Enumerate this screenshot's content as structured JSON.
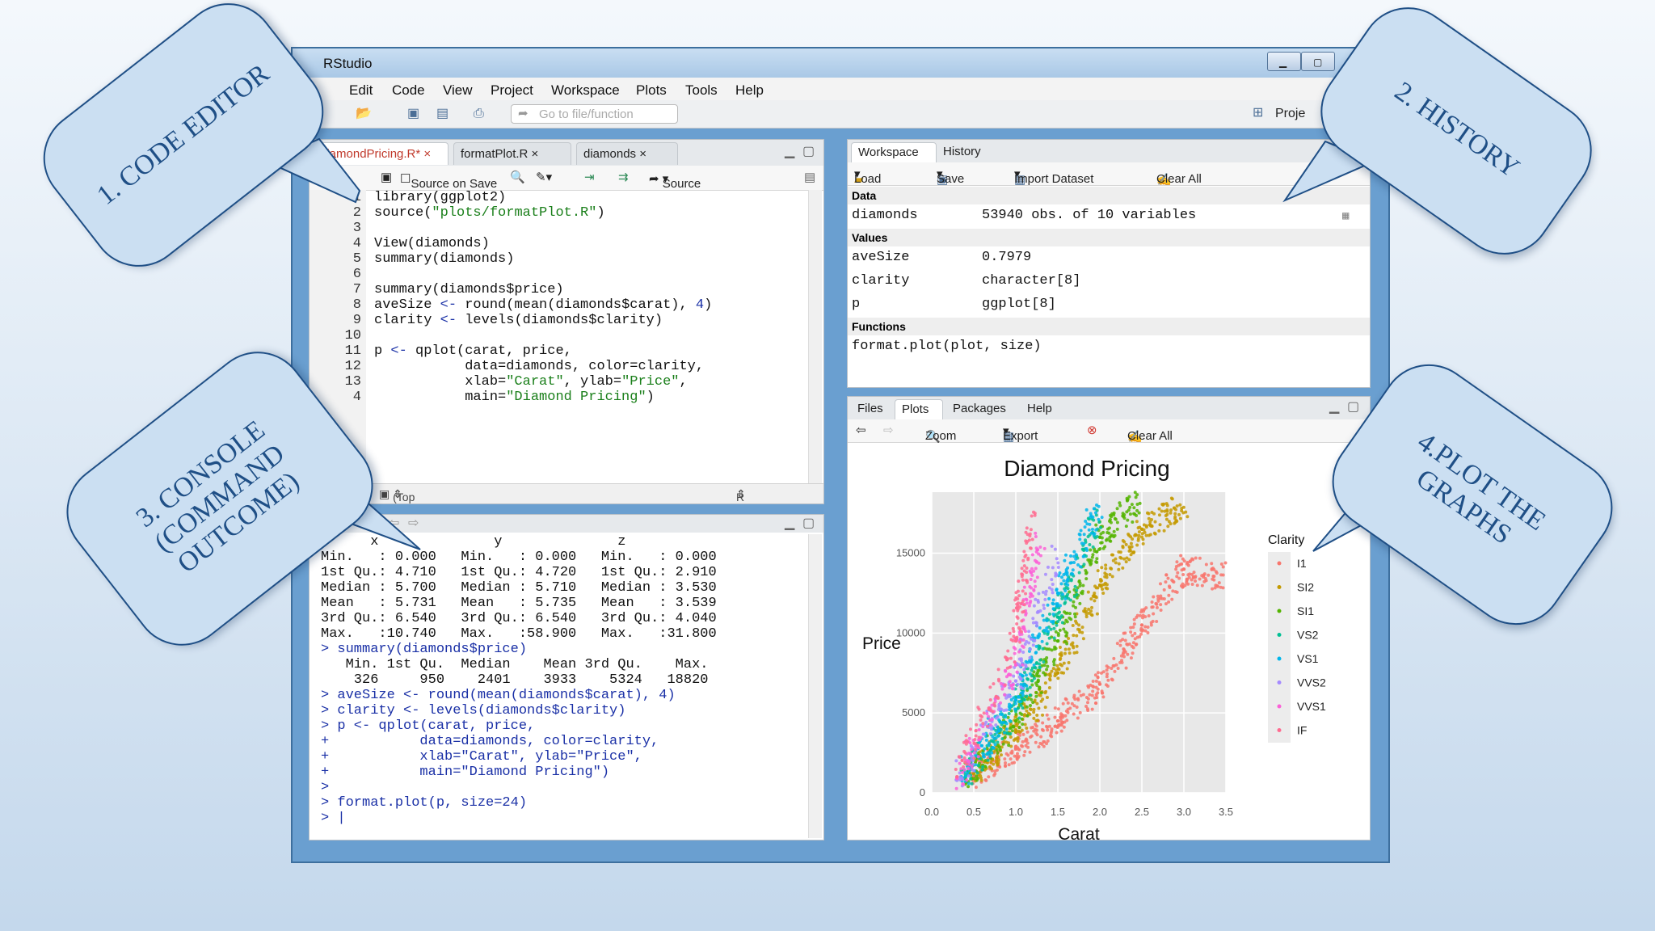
{
  "window": {
    "title": "RStudio"
  },
  "menu": [
    "Edit",
    "Code",
    "View",
    "Project",
    "Workspace",
    "Plots",
    "Tools",
    "Help"
  ],
  "toolbar": {
    "goto_placeholder": "Go to file/function",
    "project_label": "Proje"
  },
  "editor": {
    "tabs": [
      "diamondPricing.R*",
      "formatPlot.R",
      "diamonds"
    ],
    "source_on_save": "Source on Save",
    "source_button": "Source",
    "line_numbers": [
      "1",
      "2",
      "3",
      "4",
      "5",
      "6",
      "7",
      "8",
      "9",
      "10",
      "11",
      "12",
      "13",
      "4"
    ],
    "lines": [
      "library(ggplot2)",
      "source(\"plots/formatPlot.R\")",
      "",
      "View(diamonds)",
      "summary(diamonds)",
      "",
      "summary(diamonds$price)",
      "aveSize <- round(mean(diamonds$carat), 4)",
      "clarity <- levels(diamonds$clarity)",
      "",
      "p <- qplot(carat, price,",
      "           data=diamonds, color=clarity,",
      "           xlab=\"Carat\", ylab=\"Price\",",
      "           main=\"Diamond Pricing\")"
    ],
    "scope": "(Top Level)",
    "filetype": "R Script"
  },
  "console": {
    "lines": [
      {
        "t": "      x              y              z",
        "k": "out"
      },
      {
        "t": "Min.   : 0.000   Min.   : 0.000   Min.   : 0.000",
        "k": "out"
      },
      {
        "t": "1st Qu.: 4.710   1st Qu.: 4.720   1st Qu.: 2.910",
        "k": "out"
      },
      {
        "t": "Median : 5.700   Median : 5.710   Median : 3.530",
        "k": "out"
      },
      {
        "t": "Mean   : 5.731   Mean   : 5.735   Mean   : 3.539",
        "k": "out"
      },
      {
        "t": "3rd Qu.: 6.540   3rd Qu.: 6.540   3rd Qu.: 4.040",
        "k": "out"
      },
      {
        "t": "Max.   :10.740   Max.   :58.900   Max.   :31.800",
        "k": "out"
      },
      {
        "t": "> summary(diamonds$price)",
        "k": "cmd"
      },
      {
        "t": "   Min. 1st Qu.  Median    Mean 3rd Qu.    Max.",
        "k": "out"
      },
      {
        "t": "    326     950    2401    3933    5324   18820",
        "k": "out"
      },
      {
        "t": "> aveSize <- round(mean(diamonds$carat), 4)",
        "k": "cmd"
      },
      {
        "t": "> clarity <- levels(diamonds$clarity)",
        "k": "cmd"
      },
      {
        "t": "> p <- qplot(carat, price,",
        "k": "cmd"
      },
      {
        "t": "+           data=diamonds, color=clarity,",
        "k": "cmd"
      },
      {
        "t": "+           xlab=\"Carat\", ylab=\"Price\",",
        "k": "cmd"
      },
      {
        "t": "+           main=\"Diamond Pricing\")",
        "k": "cmd"
      },
      {
        "t": ">",
        "k": "cmd"
      },
      {
        "t": "> format.plot(p, size=24)",
        "k": "cmd"
      },
      {
        "t": "> |",
        "k": "cmd"
      }
    ]
  },
  "workspace": {
    "tabs": [
      "Workspace",
      "History"
    ],
    "actions": [
      "Load",
      "Save",
      "Import Dataset",
      "Clear All"
    ],
    "sections": {
      "data": "Data",
      "values": "Values",
      "functions": "Functions"
    },
    "data_rows": [
      {
        "name": "diamonds",
        "value": "53940 obs. of 10 variables"
      }
    ],
    "value_rows": [
      {
        "name": "aveSize",
        "value": "0.7979"
      },
      {
        "name": "clarity",
        "value": "character[8]"
      },
      {
        "name": "p",
        "value": "ggplot[8]"
      }
    ],
    "function_rows": [
      "format.plot(plot, size)"
    ]
  },
  "plots_pane": {
    "tabs": [
      "Files",
      "Plots",
      "Packages",
      "Help"
    ],
    "actions": [
      "Zoom",
      "Export",
      "Clear All"
    ]
  },
  "chart_data": {
    "type": "scatter",
    "title": "Diamond Pricing",
    "xlabel": "Carat",
    "ylabel": "Price",
    "xlim": [
      0,
      3.5
    ],
    "ylim": [
      0,
      18820
    ],
    "x_ticks": [
      "0.0",
      "0.5",
      "1.0",
      "1.5",
      "2.0",
      "2.5",
      "3.0",
      "3.5"
    ],
    "y_ticks": [
      "0",
      "5000",
      "10000",
      "15000"
    ],
    "grid": true,
    "legend": {
      "title": "Clarity",
      "position": "right",
      "entries": [
        "I1",
        "SI2",
        "SI1",
        "VS2",
        "VS1",
        "VVS2",
        "VVS1",
        "IF"
      ]
    },
    "series": [
      {
        "name": "I1",
        "color": "#f8766d",
        "points": [
          [
            0.5,
            1000
          ],
          [
            1.0,
            2800
          ],
          [
            1.5,
            4500
          ],
          [
            2.0,
            6800
          ],
          [
            2.5,
            10500
          ],
          [
            3.0,
            14000
          ],
          [
            3.5,
            13500
          ]
        ]
      },
      {
        "name": "SI2",
        "color": "#c49a00",
        "points": [
          [
            0.5,
            1200
          ],
          [
            1.0,
            3800
          ],
          [
            1.5,
            7500
          ],
          [
            2.0,
            13000
          ],
          [
            2.5,
            16500
          ],
          [
            3.0,
            18000
          ]
        ]
      },
      {
        "name": "SI1",
        "color": "#53b400",
        "points": [
          [
            0.4,
            900
          ],
          [
            1.0,
            4500
          ],
          [
            1.5,
            9500
          ],
          [
            2.0,
            16000
          ],
          [
            2.5,
            18500
          ]
        ]
      },
      {
        "name": "VS2",
        "color": "#00c094",
        "points": [
          [
            0.4,
            1000
          ],
          [
            1.0,
            5200
          ],
          [
            1.5,
            11000
          ],
          [
            2.0,
            17500
          ]
        ]
      },
      {
        "name": "VS1",
        "color": "#00b6eb",
        "points": [
          [
            0.35,
            1000
          ],
          [
            1.0,
            5800
          ],
          [
            1.5,
            12500
          ],
          [
            2.0,
            18000
          ]
        ]
      },
      {
        "name": "VVS2",
        "color": "#a58aff",
        "points": [
          [
            0.3,
            900
          ],
          [
            1.0,
            7000
          ],
          [
            1.5,
            15000
          ]
        ]
      },
      {
        "name": "VVS1",
        "color": "#fb61d7",
        "points": [
          [
            0.3,
            900
          ],
          [
            1.0,
            8000
          ],
          [
            1.3,
            16000
          ]
        ]
      },
      {
        "name": "IF",
        "color": "#ff6c91",
        "points": [
          [
            0.3,
            1000
          ],
          [
            1.0,
            9500
          ],
          [
            1.2,
            17500
          ]
        ]
      }
    ]
  },
  "callouts": [
    {
      "text": "1. CODE EDITOR"
    },
    {
      "text": "2. HISTORY"
    },
    {
      "text": "3. CONSOLE\n(COMMAND\nOUTCOME)"
    },
    {
      "text": "4.PLOT THE\nGRAPHS"
    }
  ]
}
